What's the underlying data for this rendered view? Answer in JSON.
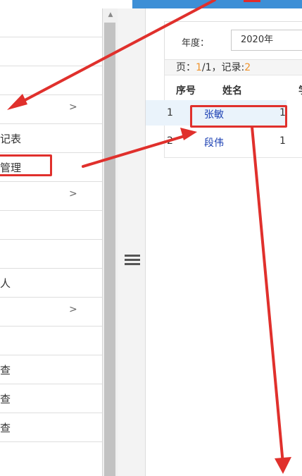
{
  "sidebar": {
    "items": [
      {
        "label": "",
        "chevron": ""
      },
      {
        "label": "",
        "chevron": ""
      },
      {
        "label": "",
        "chevron": ""
      },
      {
        "label": "",
        "chevron": ">"
      },
      {
        "label": "记表",
        "chevron": ""
      },
      {
        "label": "管理",
        "chevron": ""
      },
      {
        "label": "",
        "chevron": ">"
      },
      {
        "label": "",
        "chevron": ""
      },
      {
        "label": "",
        "chevron": ""
      },
      {
        "label": "人",
        "chevron": ""
      },
      {
        "label": "",
        "chevron": ">"
      },
      {
        "label": "",
        "chevron": ""
      },
      {
        "label": "查",
        "chevron": ""
      },
      {
        "label": "查",
        "chevron": ""
      },
      {
        "label": "查",
        "chevron": ""
      }
    ]
  },
  "scroll_up_glyph": "▲",
  "filter": {
    "year_label": "年度：",
    "year_value": "2020年"
  },
  "pager": {
    "page_prefix": "页：",
    "page_current": "1",
    "page_total": "/1，记录:",
    "record_count": "2"
  },
  "table": {
    "headers": [
      "序号",
      "姓名",
      "学"
    ],
    "rows": [
      {
        "num": "1",
        "name": "张敏",
        "cut": "1"
      },
      {
        "num": "2",
        "name": "段伟",
        "cut": "1"
      }
    ]
  },
  "colors": {
    "accent_blue": "#3d8fd6",
    "annotation_red": "#e0302c",
    "link_blue": "#1a3fb3",
    "pager_orange": "#f0932b"
  }
}
